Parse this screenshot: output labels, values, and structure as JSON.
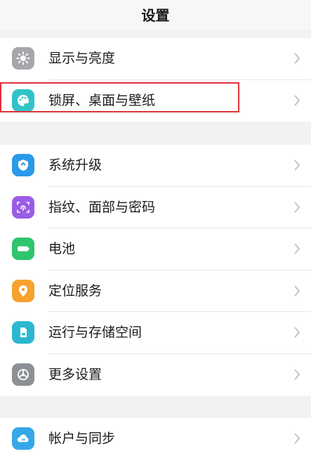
{
  "header": {
    "title": "设置"
  },
  "groups": [
    {
      "items": [
        {
          "label": "显示与亮度",
          "icon": "sun-icon",
          "color": "#a5a7ab"
        },
        {
          "label": "锁屏、桌面与壁纸",
          "icon": "palette-icon",
          "color": "#31c3c9"
        }
      ]
    },
    {
      "items": [
        {
          "label": "系统升级",
          "icon": "upgrade-shield-icon",
          "color": "#2a9ae9"
        },
        {
          "label": "指纹、面部与密码",
          "icon": "fingerprint-icon",
          "color": "#9b5ce6"
        },
        {
          "label": "电池",
          "icon": "battery-icon",
          "color": "#2ec56c"
        },
        {
          "label": "定位服务",
          "icon": "location-pin-icon",
          "color": "#f6a22c"
        },
        {
          "label": "运行与存储空间",
          "icon": "storage-card-icon",
          "color": "#2ab8cf"
        },
        {
          "label": "更多设置",
          "icon": "more-settings-icon",
          "color": "#8d9095"
        }
      ]
    },
    {
      "items": [
        {
          "label": "帐户与同步",
          "icon": "cloud-sync-icon",
          "color": "#36a7e8"
        }
      ]
    }
  ],
  "highlight": {
    "color": "#e0323b",
    "target": "锁屏、桌面与壁纸"
  }
}
